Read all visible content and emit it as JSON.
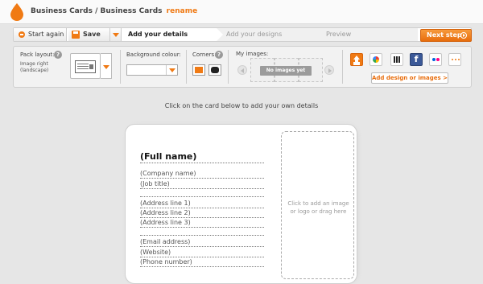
{
  "header": {
    "breadcrumb": "Business Cards / Business Cards",
    "rename_label": "rename"
  },
  "steps_bar": {
    "start_again": "Start again",
    "save": "Save",
    "steps": [
      "Add your details",
      "Add your designs",
      "Preview"
    ],
    "next_step": "Next step"
  },
  "toolbar": {
    "pack_layout_label": "Pack layout:",
    "pack_layout_value_line1": "Image right",
    "pack_layout_value_line2": "(landscape)",
    "background_colour_label": "Background colour:",
    "corners_label": "Corners:",
    "my_images_label": "My images:",
    "no_images_text": "No images yet",
    "add_design_label": "Add design or images >",
    "help_glyph": "?",
    "facebook_glyph": "f",
    "corner_colors": {
      "square": "#f07a14",
      "rounded": "#222222"
    }
  },
  "main": {
    "instruction": "Click on the card below to add your own details"
  },
  "card": {
    "full_name": "(Full name)",
    "fields": [
      "(Company name)",
      "(Job title)",
      "",
      "(Address line 1)",
      "(Address line 2)",
      "(Address line 3)",
      "",
      "(Email address)",
      "(Website)",
      "(Phone number)"
    ],
    "image_dropzone_text": "Click to add an image or logo or drag here"
  },
  "accent_color": "#f07a14"
}
